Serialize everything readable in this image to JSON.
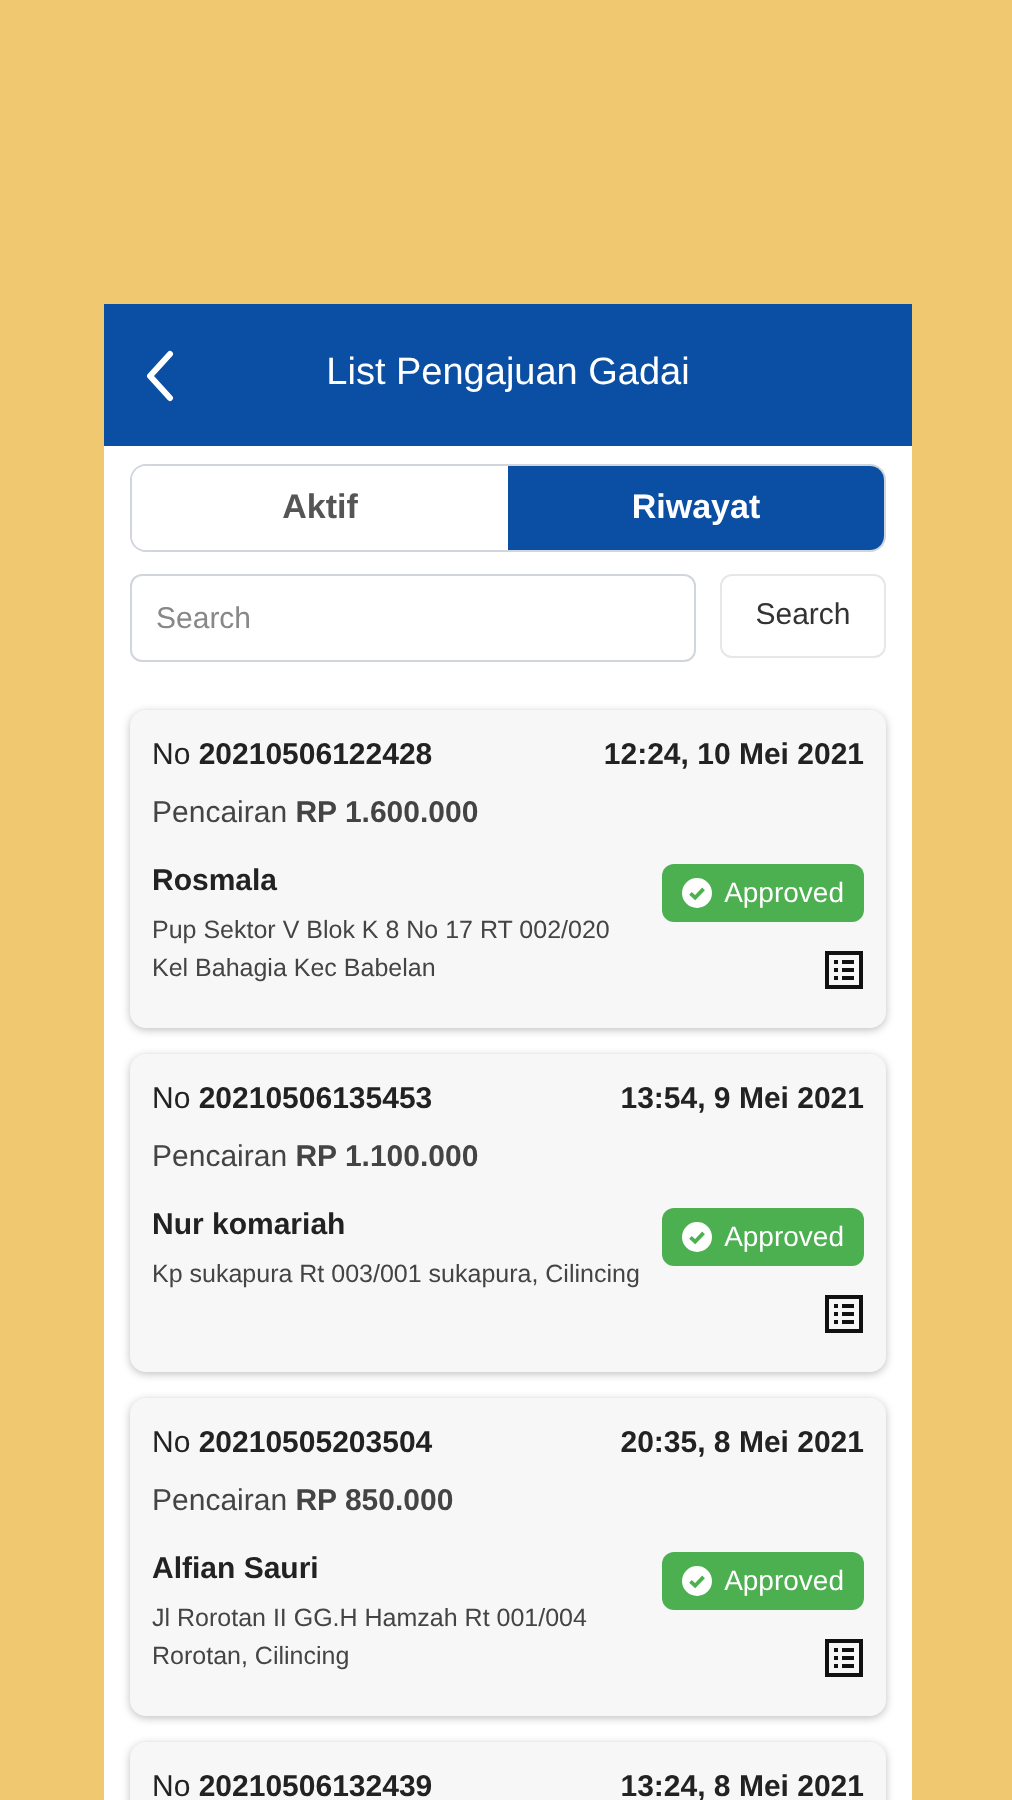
{
  "header": {
    "title": "List Pengajuan Gadai"
  },
  "tabs": [
    {
      "label": "Aktif",
      "selected": false
    },
    {
      "label": "Riwayat",
      "selected": true
    }
  ],
  "search": {
    "placeholder": "Search",
    "button": "Search"
  },
  "items": [
    {
      "number": "No **20210506122428**",
      "time": "12:24, 10 Mei 2021",
      "amount": "Pencairan **RP 1.600.000**",
      "name": "Rosmala",
      "address": "Pup Sektor V Blok K 8 No 17 RT 002/020 Kel Bahagia Kec Babelan",
      "status": "Approved"
    },
    {
      "number": "No **20210506135453**",
      "time": "13:54, 9 Mei 2021",
      "amount": "Pencairan **RP 1.100.000**",
      "name": "Nur komariah",
      "address": "Kp sukapura Rt 003/001 sukapura, Cilincing",
      "status": "Approved"
    },
    {
      "number": "No **20210505203504**",
      "time": "20:35, 8 Mei 2021",
      "amount": "Pencairan **RP 850.000**",
      "name": "Alfian Sauri",
      "address": "Jl Rorotan II GG.H Hamzah Rt 001/004 Rorotan, Cilincing",
      "status": "Approved"
    },
    {
      "number": "No **20210506132439**",
      "time": "13:24, 8 Mei 2021"
    }
  ]
}
